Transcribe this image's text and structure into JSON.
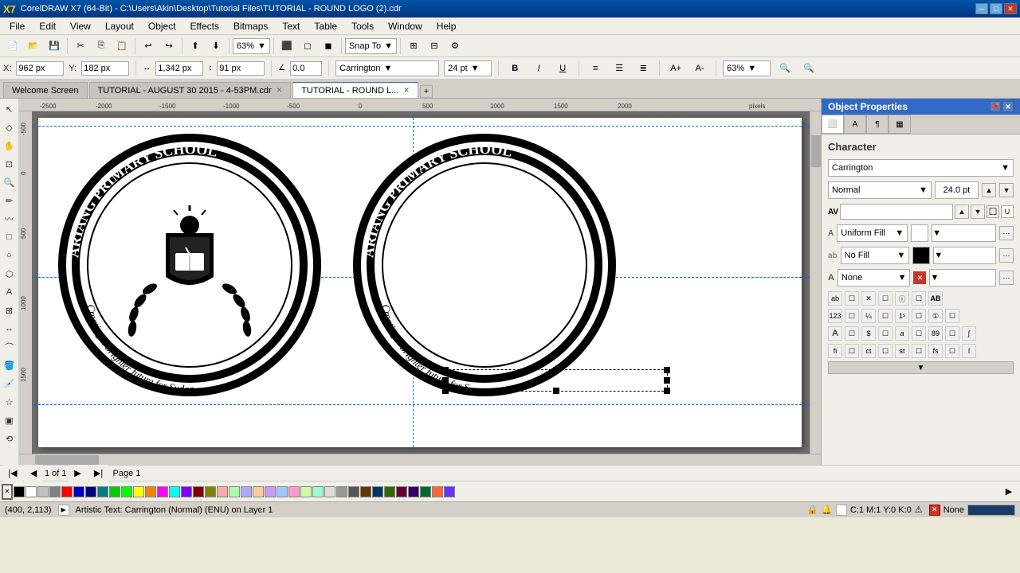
{
  "titlebar": {
    "title": "CorelDRAW X7 (64-Bit) - C:\\Users\\Akin\\Desktop\\Tutorial Files\\TUTORIAL - ROUND LOGO (2).cdr",
    "min_label": "─",
    "max_label": "□",
    "close_label": "✕"
  },
  "menu": {
    "items": [
      "File",
      "Edit",
      "View",
      "Layout",
      "Object",
      "Effects",
      "Bitmaps",
      "Text",
      "Table",
      "Tools",
      "Window",
      "Help"
    ]
  },
  "toolbar1": {
    "zoom_value": "63%",
    "snap_label": "Snap To"
  },
  "coordbar": {
    "x_label": "X:",
    "x_value": "962 px",
    "y_label": "Y:",
    "y_value": "182 px",
    "w_value": "1,342 px",
    "h_value": "91 px",
    "angle_value": "0.0",
    "font_name": "Carrington",
    "font_size": "24 pt",
    "zoom2_value": "63%"
  },
  "tabs": [
    {
      "label": "Welcome Screen",
      "active": false
    },
    {
      "label": "TUTORIAL - AUGUST 30 2015 - 4-53PM.cdr",
      "active": false
    },
    {
      "label": "TUTORIAL - ROUND L...",
      "active": true
    }
  ],
  "ruler": {
    "marks": [
      "-2500",
      "-2000",
      "-1500",
      "-1000",
      "-500",
      "0",
      "500",
      "1000",
      "1500",
      "2000"
    ]
  },
  "canvas": {
    "page_label": "Page 1",
    "page_info": "1 of 1"
  },
  "rightpanel": {
    "title": "Object Properties",
    "section": "Character",
    "font_name": "Carrington",
    "font_style": "Normal",
    "font_size": "24.0 pt",
    "fill_label": "Uniform Fill",
    "outline_label": "No Fill",
    "effect_label": "None",
    "av_placeholder": ""
  },
  "statusbar": {
    "coord": "(400, 2,113)",
    "status": "Artistic Text: Carrington (Normal) (ENU) on Layer 1",
    "color_info": "C:1 M:1 Y:0 K:0",
    "none_label": "None"
  },
  "colors": {
    "swatches": [
      "#000000",
      "#ffffff",
      "#808080",
      "#c0c0c0",
      "#ff0000",
      "#00ff00",
      "#0000ff",
      "#ffff00",
      "#00ffff",
      "#ff00ff",
      "#ff8000",
      "#8000ff",
      "#008000",
      "#000080",
      "#800000",
      "#ff9999",
      "#99ff99",
      "#9999ff",
      "#ffcc99",
      "#cc99ff",
      "#99ccff",
      "#ff99cc",
      "#ccff99",
      "#99ffcc",
      "#cccccc",
      "#999999",
      "#666666",
      "#333333",
      "#ff6600",
      "#6600ff",
      "#0066ff",
      "#66ff00",
      "#00ff66",
      "#ff0066",
      "#663300",
      "#003366",
      "#336600",
      "#660033",
      "#330066",
      "#006633"
    ]
  }
}
